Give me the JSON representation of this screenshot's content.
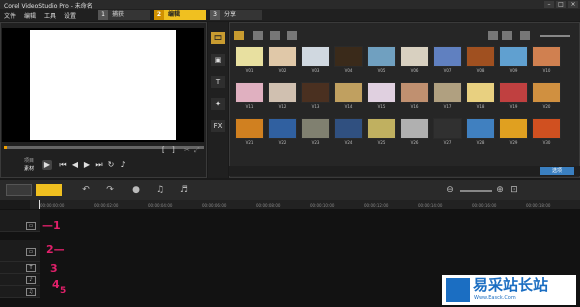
{
  "window": {
    "title": "Corel VideoStudio Pro - 未命名",
    "minimize": "–",
    "maximize": "□",
    "close": "×"
  },
  "menu": [
    "文件",
    "编辑",
    "工具",
    "设置"
  ],
  "steps": [
    {
      "num": "1",
      "label": "捕获"
    },
    {
      "num": "2",
      "label": "编辑",
      "active": true
    },
    {
      "num": "3",
      "label": "分享"
    }
  ],
  "player": {
    "project_label": "项目",
    "clip_label": "素材",
    "mark_in": "[",
    "mark_out": "]"
  },
  "tools": [
    "🎞",
    "▣",
    "T",
    "✦",
    "FX"
  ],
  "library": {
    "thumb_labels": [
      "V01",
      "V02",
      "V03",
      "V04",
      "V05",
      "V06",
      "V07",
      "V08",
      "V09",
      "V10",
      "V11",
      "V12",
      "V13",
      "V14",
      "V15",
      "V16",
      "V17",
      "V18",
      "V19",
      "V20",
      "V21",
      "V22",
      "V23",
      "V24",
      "V25",
      "V26",
      "V27",
      "V28",
      "V29",
      "V30"
    ],
    "thumb_colors": [
      "#e8e0a0",
      "#e0c8a8",
      "#d0d8e0",
      "#3a2a1a",
      "#70a0c0",
      "#d8d0c0",
      "#6080c0",
      "#a05020",
      "#60a0d0",
      "#d08050",
      "#e0b0c0",
      "#d0c0b0",
      "#4a3020",
      "#c0a060",
      "#e0d0e0",
      "#c09070",
      "#b0a080",
      "#e8d080",
      "#c04040",
      "#d09040",
      "#d08020",
      "#3060a0",
      "#808070",
      "#305080",
      "#c0b060",
      "#b0b0b0",
      "#303030",
      "#4080c0",
      "#e0a020",
      "#d05020"
    ],
    "options_label": "选项"
  },
  "timeline": {
    "ruler_ticks": [
      "00:00:00:00",
      "00:00:02:00",
      "00:00:04:00",
      "00:00:06:00",
      "00:00:08:00",
      "00:00:10:00",
      "00:00:12:00",
      "00:00:14:00",
      "00:00:16:00",
      "00:00:18:00"
    ]
  },
  "annotations": [
    "1",
    "2",
    "3",
    "4",
    "5"
  ],
  "watermark": {
    "text": "易采站长站",
    "sub": "Www.Easck.Com"
  }
}
